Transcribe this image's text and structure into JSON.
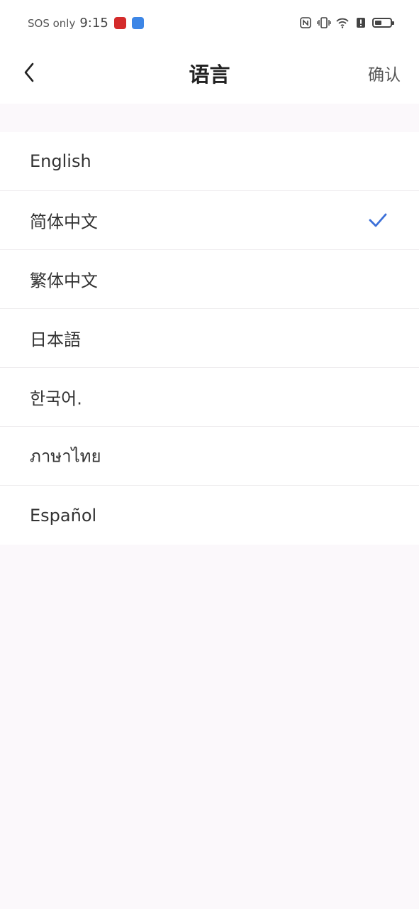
{
  "status_bar": {
    "carrier": "SOS only",
    "time": "9:15",
    "icons": [
      "app-badge-red",
      "app-badge-blue",
      "nfc-icon",
      "vibrate-icon",
      "wifi-icon",
      "alert-icon",
      "battery-icon"
    ],
    "battery_level": 0.45
  },
  "header": {
    "title": "语言",
    "confirm_label": "确认",
    "back_icon": "chevron-left-icon"
  },
  "languages": [
    {
      "label": "English",
      "selected": false
    },
    {
      "label": "简体中文",
      "selected": true
    },
    {
      "label": "繁体中文",
      "selected": false
    },
    {
      "label": "日本語",
      "selected": false
    },
    {
      "label": "한국어.",
      "selected": false
    },
    {
      "label": "ภาษาไทย",
      "selected": false
    },
    {
      "label": "Español",
      "selected": false
    }
  ],
  "colors": {
    "accent": "#3b6fd8",
    "background": "#fbf8fb",
    "surface": "#ffffff",
    "divider": "#efedef"
  }
}
